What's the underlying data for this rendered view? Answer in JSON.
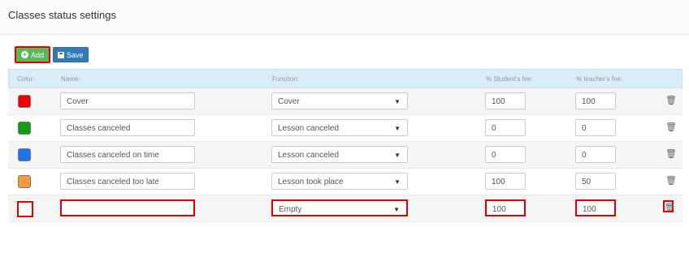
{
  "header": {
    "title": "Classes status settings"
  },
  "toolbar": {
    "add_label": "Add",
    "save_label": "Save"
  },
  "table": {
    "columns": {
      "color": "Color:",
      "name": "Name:",
      "function": "Function:",
      "student_fee": "% Student's fee:",
      "teacher_fee": "% teacher's fee:"
    },
    "rows": [
      {
        "color": "#ee0000",
        "name": "Cover",
        "function": "Cover",
        "student_fee": "100",
        "teacher_fee": "100"
      },
      {
        "color": "#129e12",
        "name": "Classes canceled",
        "function": "Lesson canceled",
        "student_fee": "0",
        "teacher_fee": "0"
      },
      {
        "color": "#1e73f0",
        "name": "Classes canceled on time",
        "function": "Lesson canceled",
        "student_fee": "0",
        "teacher_fee": "0"
      },
      {
        "color": "#f79a3a",
        "name": "Classes canceled too late",
        "function": "Lesson took place",
        "student_fee": "100",
        "teacher_fee": "50"
      },
      {
        "color": "",
        "name": "",
        "function": "Empty",
        "student_fee": "100",
        "teacher_fee": "100"
      }
    ]
  },
  "icons": {
    "add": "plus-circle-icon",
    "save": "floppy-disk-icon",
    "delete": "trash-icon",
    "dropdown": "caret-down-icon"
  }
}
